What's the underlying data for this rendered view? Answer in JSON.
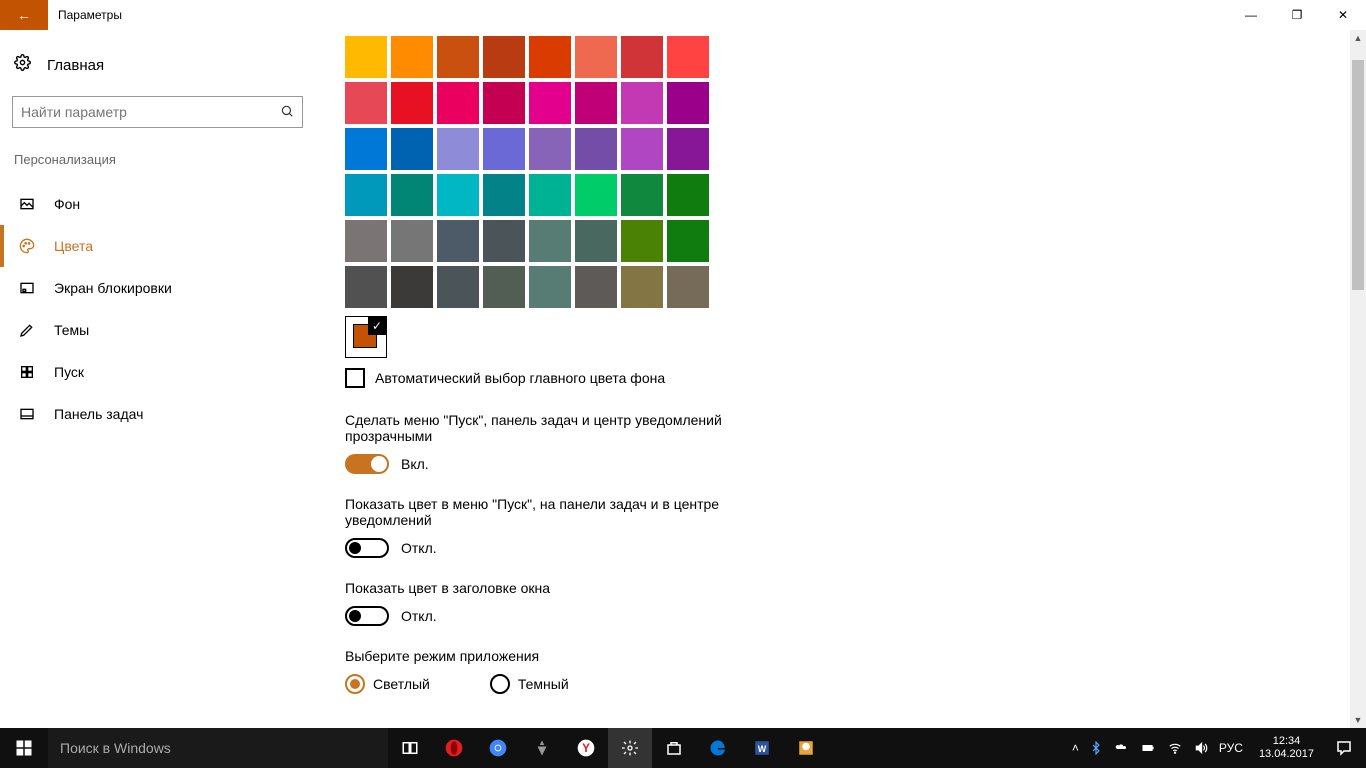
{
  "window": {
    "title": "Параметры",
    "minimize": "—",
    "maximize": "❐",
    "close": "✕",
    "back": "←"
  },
  "sidebar": {
    "home": "Главная",
    "search_placeholder": "Найти параметр",
    "section": "Персонализация",
    "items": [
      {
        "label": "Фон"
      },
      {
        "label": "Цвета"
      },
      {
        "label": "Экран блокировки"
      },
      {
        "label": "Темы"
      },
      {
        "label": "Пуск"
      },
      {
        "label": "Панель задач"
      }
    ]
  },
  "colors": {
    "grid": [
      [
        "#ffb900",
        "#ff8c00",
        "#ca5010",
        "#b83b11",
        "#da3b01",
        "#ef6950",
        "#d13438",
        "#ff4343"
      ],
      [
        "#e74856",
        "#e81123",
        "#ea005e",
        "#c30052",
        "#e3008c",
        "#bf0077",
        "#c239b3",
        "#9a0089"
      ],
      [
        "#0078d7",
        "#0063b1",
        "#8e8cd8",
        "#6b69d6",
        "#8764b8",
        "#744da9",
        "#b146c2",
        "#881798"
      ],
      [
        "#0099bc",
        "#018574",
        "#00b7c3",
        "#038387",
        "#00b294",
        "#00cc6a",
        "#10893e",
        "#107c10"
      ],
      [
        "#7a7574",
        "#767676",
        "#4c5b67",
        "#4a5459",
        "#567c73",
        "#486860",
        "#498205",
        "#107c10"
      ],
      [
        "#515151",
        "#3b3a39",
        "#4a5459",
        "#525e54",
        "#567c73",
        "#5d5a58",
        "#847545",
        "#766b59"
      ]
    ],
    "selected": "#c15303",
    "auto_checkbox": "Автоматический выбор главного цвета фона"
  },
  "options": {
    "transparency": {
      "label": "Сделать меню \"Пуск\", панель задач и центр уведомлений прозрачными",
      "value": "Вкл."
    },
    "show_color_start": {
      "label": "Показать цвет в меню \"Пуск\", на панели задач и в центре уведомлений",
      "value": "Откл."
    },
    "show_color_title": {
      "label": "Показать цвет в заголовке окна",
      "value": "Откл."
    },
    "app_mode": {
      "label": "Выберите режим приложения",
      "light": "Светлый",
      "dark": "Темный"
    }
  },
  "taskbar": {
    "search": "Поиск в Windows",
    "lang": "РУС",
    "time": "12:34",
    "date": "13.04.2017"
  }
}
